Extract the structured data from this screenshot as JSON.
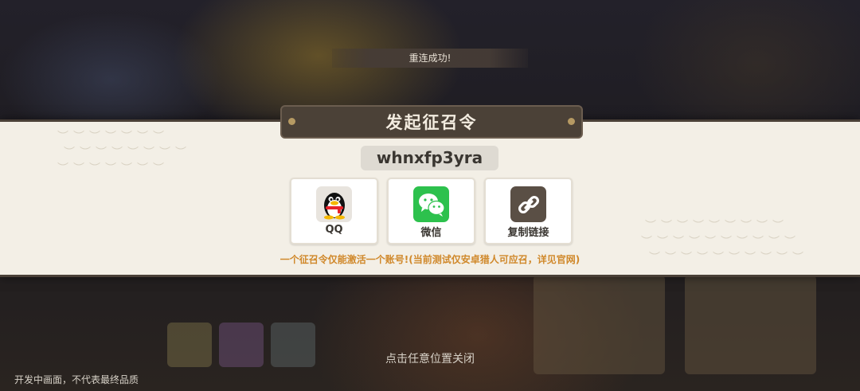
{
  "toast": {
    "text": "重连成功!"
  },
  "dialog": {
    "title": "发起征召令",
    "code": "whnxfp3yra",
    "share_options": [
      {
        "label": "QQ",
        "icon": "qq-penguin-icon"
      },
      {
        "label": "微信",
        "icon": "wechat-icon"
      },
      {
        "label": "复制链接",
        "icon": "link-icon"
      }
    ],
    "warning": "一个征召令仅能激活一个账号!(当前测试仅安卓猎人可应召，详见官网)"
  },
  "close_hint": "点击任意位置关闭",
  "footnote": "开发中画面，不代表最终品质",
  "colors": {
    "band": "#f3efe6",
    "banner": "#4b4137",
    "warning": "#d0882a",
    "wechat": "#2dc14d"
  }
}
